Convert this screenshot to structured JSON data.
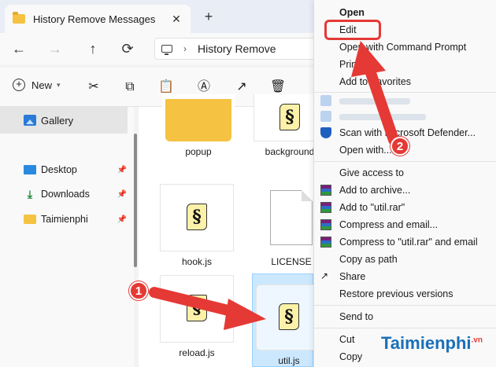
{
  "tab": {
    "title": "History Remove Messages",
    "close": "✕",
    "new": "+"
  },
  "nav": {
    "back": "←",
    "forward": "→",
    "up": "↑",
    "refresh": "⟳",
    "address": "History Remove",
    "chevron": "›"
  },
  "toolbar": {
    "new_label": "New",
    "dropdown": "▾"
  },
  "sidebar": {
    "gallery": "Gallery",
    "items": [
      {
        "label": "Desktop",
        "icon": "desktop-icon"
      },
      {
        "label": "Downloads",
        "icon": "downloads-icon"
      },
      {
        "label": "Taimienphi",
        "icon": "folder-icon"
      }
    ]
  },
  "files": [
    {
      "name": "popup",
      "type": "folder"
    },
    {
      "name": "background",
      "type": "js"
    },
    {
      "name": "hook.js",
      "type": "js"
    },
    {
      "name": "LICENSE",
      "type": "file"
    },
    {
      "name": "reload.js",
      "type": "js"
    },
    {
      "name": "util.js",
      "type": "js",
      "selected": true
    }
  ],
  "menu": {
    "items": [
      {
        "label": "Open",
        "bold": true
      },
      {
        "label": "Edit"
      },
      {
        "label": "Open with Command Prompt"
      },
      {
        "label": "Print"
      },
      {
        "label": "Add to Favorites"
      },
      {
        "label": "Scan with Microsoft Defender..."
      },
      {
        "label": "Open with..."
      },
      {
        "label": "Give access to"
      },
      {
        "label": "Add to archive..."
      },
      {
        "label": "Add to \"util.rar\""
      },
      {
        "label": "Compress and email..."
      },
      {
        "label": "Compress to \"util.rar\" and email"
      },
      {
        "label": "Copy as path"
      },
      {
        "label": "Share"
      },
      {
        "label": "Restore previous versions"
      },
      {
        "label": "Send to"
      },
      {
        "label": "Cut"
      },
      {
        "label": "Copy"
      }
    ]
  },
  "annotations": {
    "badge1": "1",
    "badge2": "2",
    "color": "#e53935"
  },
  "watermark": {
    "text": "Taimienphi",
    "suffix": ".vn"
  }
}
